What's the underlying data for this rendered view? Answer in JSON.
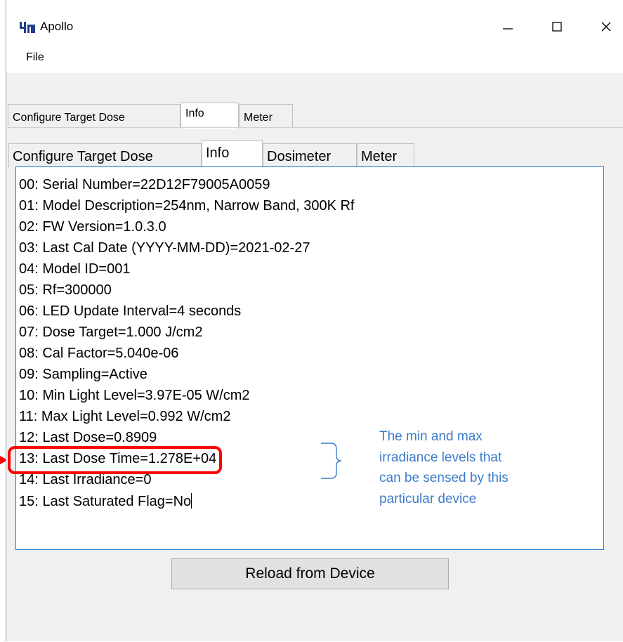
{
  "window": {
    "title": "Apollo",
    "minimize_icon": "minimize-icon",
    "maximize_icon": "maximize-icon",
    "close_icon": "close-icon"
  },
  "menu": {
    "file_label": "File"
  },
  "outer_tabs": [
    {
      "label": "Configure Target Dose"
    },
    {
      "label": "Info"
    },
    {
      "label": "Meter"
    }
  ],
  "inner_tabs": [
    {
      "label": "Configure Target Dose"
    },
    {
      "label": "Info"
    },
    {
      "label": "Dosimeter"
    },
    {
      "label": "Meter"
    }
  ],
  "info_lines": [
    "00: Serial Number=22D12F79005A0059",
    "01: Model Description=254nm, Narrow Band, 300K Rf",
    "02: FW Version=1.0.3.0",
    "03: Last Cal Date (YYYY-MM-DD)=2021-02-27",
    "04: Model ID=001",
    "05: Rf=300000",
    "06: LED Update Interval=4 seconds",
    "07: Dose Target=1.000 J/cm2",
    "08: Cal Factor=5.040e-06",
    "09: Sampling=Active",
    "10: Min Light Level=3.97E-05 W/cm2",
    "11: Max Light Level=0.992 W/cm2",
    "12: Last Dose=0.8909",
    "13: Last Dose Time=1.278E+04",
    "14: Last Irradiance=0",
    "15: Last Saturated Flag=No"
  ],
  "reload_button": "Reload from Device",
  "annotation": {
    "lines": [
      "The min and max",
      "irradiance levels that",
      "can be sensed by this",
      "particular device"
    ]
  },
  "colors": {
    "annotation_text": "#3d7cc9",
    "highlight_box": "#ff0000",
    "textbox_border": "#1e7bd4",
    "window_bg": "#f0f0f0"
  }
}
